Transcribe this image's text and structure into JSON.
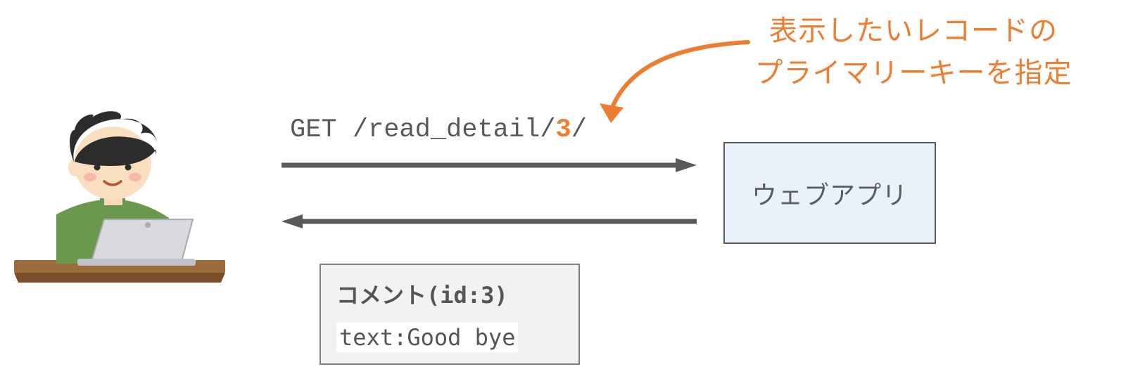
{
  "annotation": {
    "line1": "表示したいレコードの",
    "line2": "プライマリーキーを指定"
  },
  "request": {
    "prefix": "GET /read_detail/",
    "pk": "3",
    "suffix": "/"
  },
  "webapp": {
    "label": "ウェブアプリ"
  },
  "response": {
    "title": "コメント(id:3)",
    "body": "text:Good bye"
  },
  "colors": {
    "accent": "#ed7d31",
    "box_bg": "#e9f2fb",
    "text": "#595959",
    "arrow": "#595959"
  }
}
